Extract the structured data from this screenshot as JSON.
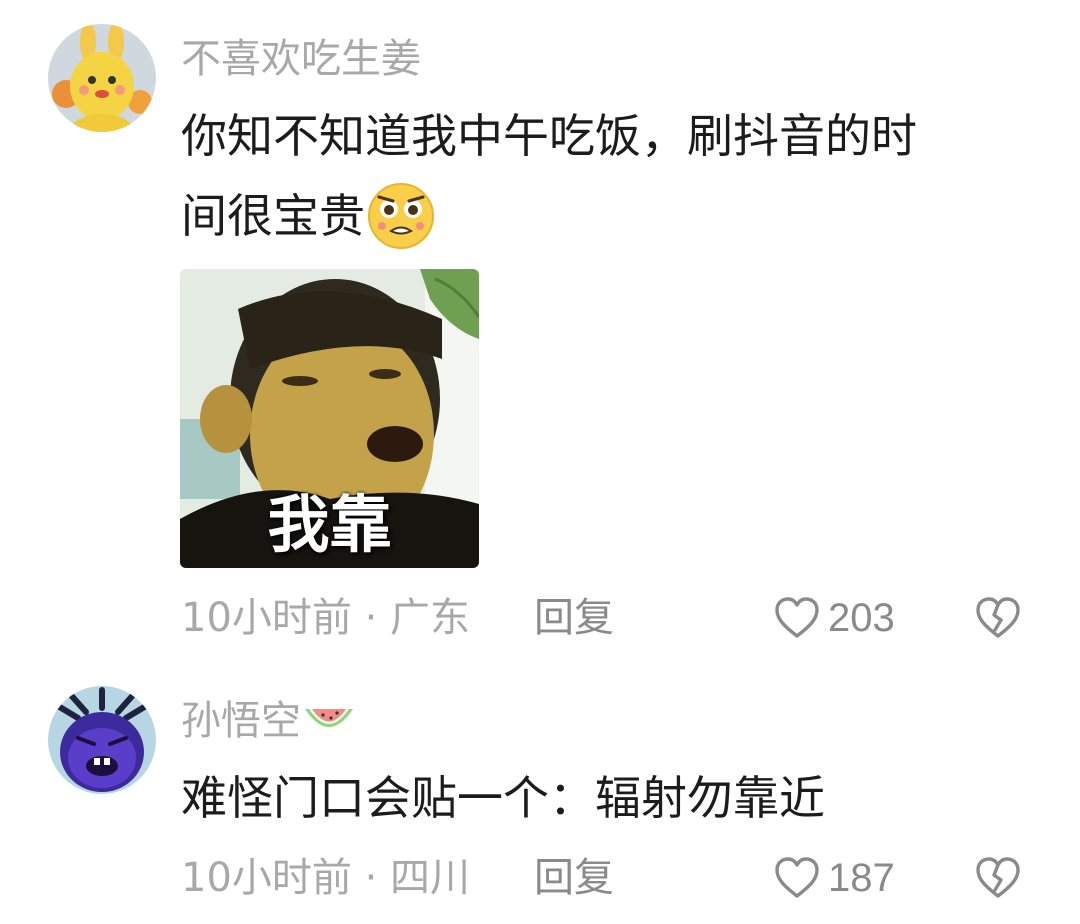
{
  "comments": [
    {
      "username": "不喜欢吃生姜",
      "text_line1": "你知不知道我中午吃饭，刷抖音的时",
      "text_line2": "间很宝贵",
      "emoji_icon": "pleading-face-emoji-icon",
      "meme_caption": "我靠",
      "time_location": "10小时前 · 广东",
      "reply_label": "回复",
      "likes": "203",
      "avatar_icon": "yellow-rabbit-mascot-avatar"
    },
    {
      "username": "孙悟空",
      "username_badge_icon": "watermelon-icon",
      "text_line1": "难怪门口会贴一个：辐射勿靠近",
      "time_location": "10小时前 · 四川",
      "reply_label": "回复",
      "likes": "187",
      "avatar_icon": "purple-monster-avatar"
    }
  ],
  "colors": {
    "text": "#1c1c1c",
    "meta": "#a8a8a8",
    "icon": "#8a8a8a"
  }
}
